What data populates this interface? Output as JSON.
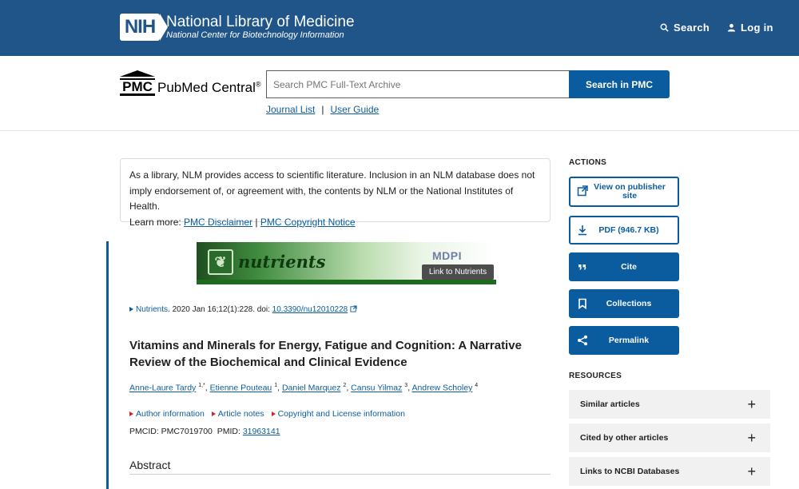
{
  "header": {
    "logo_text": "NIH",
    "title": "National Library of Medicine",
    "subtitle": "National Center for Biotechnology Information",
    "search_label": "Search",
    "login_label": "Log in"
  },
  "pmc": {
    "logo_text": "PMC",
    "name": "PubMed Central",
    "registered": "®",
    "search_placeholder": "Search PMC Full-Text Archive",
    "search_button": "Search in PMC",
    "journal_list": "Journal List",
    "separator": "|",
    "user_guide": "User Guide"
  },
  "disclaimer": {
    "text": "As a library, NLM provides access to scientific literature. Inclusion in an NLM database does not imply endorsement of, or agreement with, the contents by NLM or the National Institutes of Health.",
    "learn_more": "Learn more:",
    "link1": "PMC Disclaimer",
    "sep": "|",
    "link2": "PMC Copyright Notice"
  },
  "banner": {
    "journal_word": "nutrients",
    "publisher": "MDPI",
    "tooltip": "Link to Nutrients"
  },
  "citation": {
    "journal": "Nutrients",
    "details": ". 2020 Jan 16;12(1):228. doi: ",
    "doi": "10.3390/nu12010228"
  },
  "article": {
    "title": "Vitamins and Minerals for Energy, Fatigue and Cognition: A Narrative Review of the Biochemical and Clinical Evidence",
    "authors": [
      {
        "name": "Anne-Laure Tardy",
        "sup": "1,*"
      },
      {
        "name": "Etienne Pouteau",
        "sup": "1"
      },
      {
        "name": "Daniel Marquez",
        "sup": "2"
      },
      {
        "name": "Cansu Yilmaz",
        "sup": "3"
      },
      {
        "name": "Andrew Scholey",
        "sup": "4"
      }
    ],
    "info_links": [
      "Author information",
      "Article notes",
      "Copyright and License information"
    ],
    "pmcid_label": "PMCID: PMC7019700",
    "pmid_label": "PMID:",
    "pmid": "31963141",
    "abstract_heading": "Abstract"
  },
  "sidebar": {
    "actions_heading": "ACTIONS",
    "actions": [
      {
        "label": "View on publisher site",
        "icon": "external-link-icon"
      },
      {
        "label": "PDF (946.7 KB)",
        "icon": "download-icon"
      },
      {
        "label": "Cite",
        "icon": "quote-icon"
      },
      {
        "label": "Collections",
        "icon": "bookmark-icon"
      },
      {
        "label": "Permalink",
        "icon": "share-icon"
      }
    ],
    "resources_heading": "RESOURCES",
    "resources": [
      "Similar articles",
      "Cited by other articles",
      "Links to NCBI Databases"
    ],
    "expand_symbol": "+"
  },
  "colors": {
    "nih_blue": "#20558a",
    "link_blue": "#0b5c9e",
    "accent_red": "#d02533"
  }
}
